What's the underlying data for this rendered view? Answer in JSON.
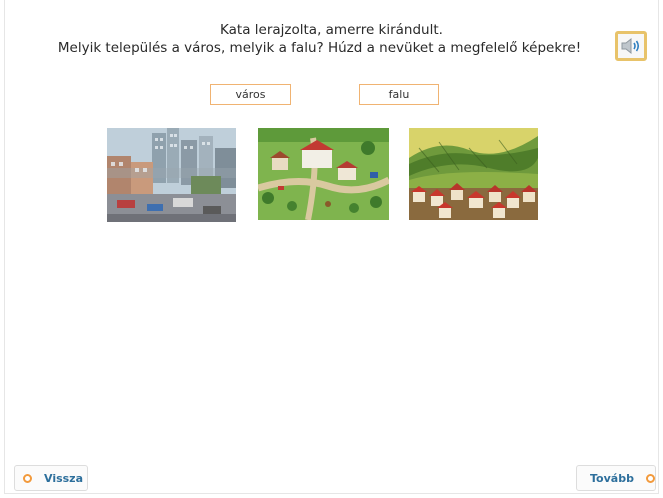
{
  "instruction": {
    "line1": "Kata lerajzolta, amerre kirándult.",
    "line2": "Melyik település a város, melyik a falu? Húzd a nevüket a megfelelő képekre!"
  },
  "sound_button": {
    "icon": "speaker-icon"
  },
  "labels": [
    {
      "text": "város"
    },
    {
      "text": "falu"
    }
  ],
  "images": [
    {
      "subject": "city-drawing"
    },
    {
      "subject": "village-drawing"
    },
    {
      "subject": "hillside-village-drawing"
    }
  ],
  "nav": {
    "back_label": "Vissza",
    "next_label": "Tovább"
  },
  "colors": {
    "label_border": "#f0b372",
    "nav_text": "#2d6f9c",
    "nav_dot": "#f29a3c",
    "sound_border": "#e8c36a"
  }
}
